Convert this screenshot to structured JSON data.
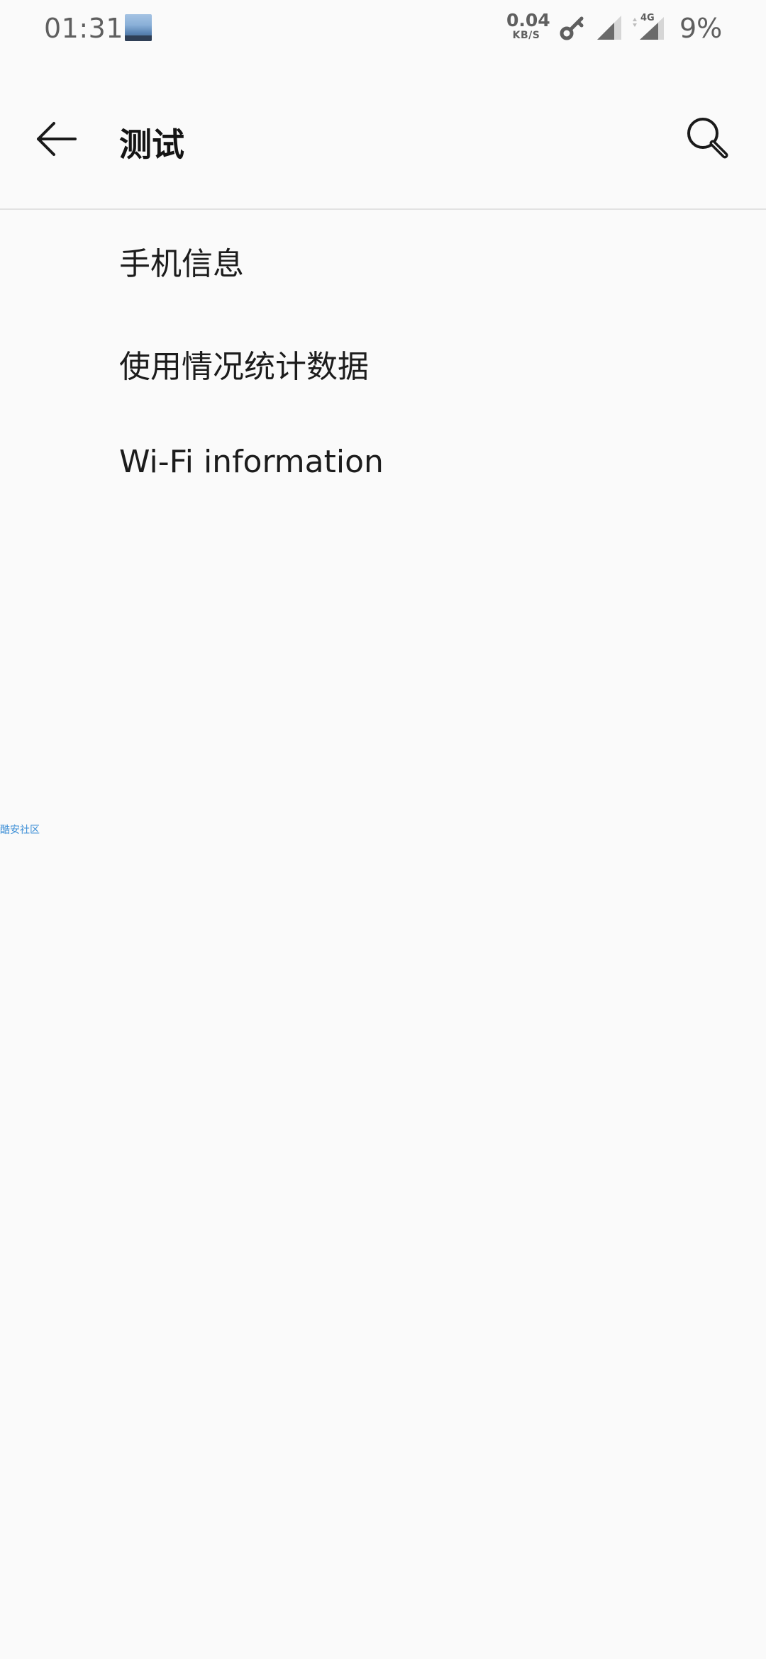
{
  "status_bar": {
    "time": "01:31",
    "net_speed_value": "0.04",
    "net_speed_unit": "KB/S",
    "network_type": "4G",
    "battery": "9%"
  },
  "toolbar": {
    "title": "测试"
  },
  "menu": {
    "items": [
      {
        "label": "手机信息"
      },
      {
        "label": "使用情况统计数据"
      },
      {
        "label": "Wi-Fi information"
      }
    ]
  },
  "watermark": "酷安社区",
  "colors": {
    "background": "#fafafa",
    "text_primary": "#1c1c1c",
    "status_text": "#5f5f5f",
    "divider": "#e2e2e2",
    "watermark": "#3d8fd6"
  }
}
